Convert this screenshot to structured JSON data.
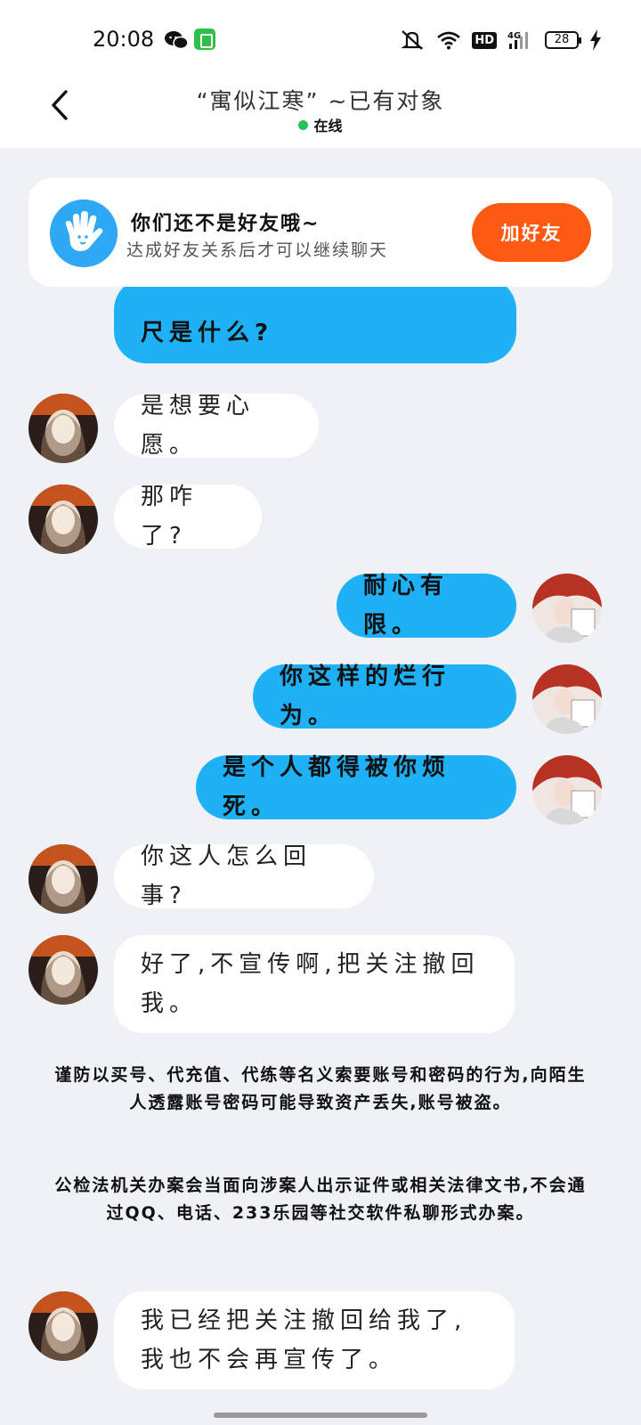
{
  "status_bar": {
    "time": "20:08",
    "hd_label": "HD",
    "network_label": "4G",
    "battery_level": "28",
    "icons": [
      "wechat-icon",
      "app-store-icon",
      "mute-icon",
      "wifi-icon",
      "hd-icon",
      "signal-icon",
      "battery-icon",
      "charging-icon"
    ]
  },
  "header": {
    "title": "“寓似江寒” ~已有对象",
    "status": "在线",
    "status_color": "#26c35a"
  },
  "friend_banner": {
    "title": "你们还不是好友哦~",
    "subtitle": "达成好友关系后才可以继续聊天",
    "button_label": "加好友",
    "button_color": "#ff5a14"
  },
  "messages": [
    {
      "side": "out",
      "text": "尺是什么?"
    },
    {
      "side": "in",
      "text": "是想要心愿。"
    },
    {
      "side": "in",
      "text": "那咋了?"
    },
    {
      "side": "out",
      "text": "耐心有限。"
    },
    {
      "side": "out",
      "text": "你这样的烂行为。"
    },
    {
      "side": "out",
      "text": "是个人都得被你烦死。"
    },
    {
      "side": "in",
      "text": "你这人怎么回事?"
    },
    {
      "side": "in",
      "text": "好了,不宣传啊,把关注撤回我。"
    },
    {
      "side": "in",
      "text": "我已经把关注撤回给我了,我也不会再宣传了。"
    }
  ],
  "notices": {
    "first": "谨防以买号、代充值、代练等名义索要账号和密码的行为,向陌生人透露账号密码可能导致资产丢失,账号被盗。",
    "second": "公检法机关办案会当面向涉案人出示证件或相关法律文书,不会通过QQ、电话、233乐园等社交软件私聊形式办案。"
  },
  "colors": {
    "outgoing_bubble": "#1eb1f6",
    "incoming_bubble": "#ffffff",
    "chat_background": "#eef1f6"
  }
}
